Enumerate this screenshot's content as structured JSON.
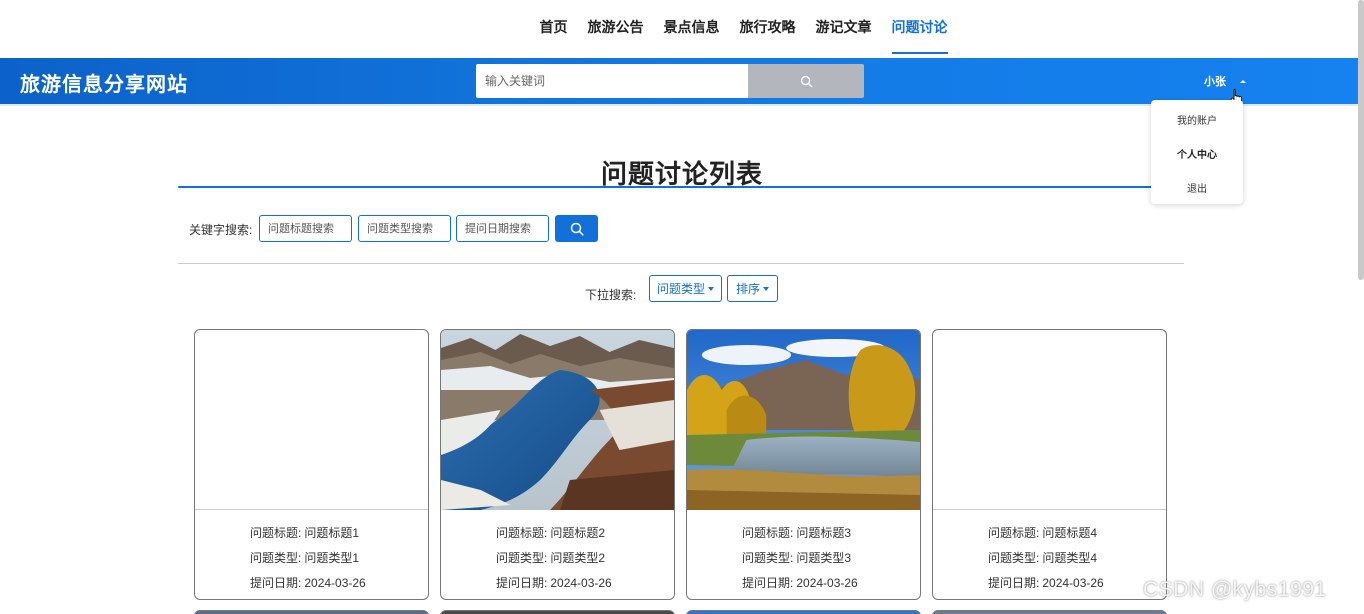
{
  "nav": {
    "items": [
      {
        "label": "首页",
        "active": false
      },
      {
        "label": "旅游公告",
        "active": false
      },
      {
        "label": "景点信息",
        "active": false
      },
      {
        "label": "旅行攻略",
        "active": false
      },
      {
        "label": "游记文章",
        "active": false
      },
      {
        "label": "问题讨论",
        "active": true
      }
    ]
  },
  "header": {
    "site_title": "旅游信息分享网站",
    "search_placeholder": "输入关键词",
    "user_name": "小张"
  },
  "user_menu": {
    "items": [
      {
        "label": "我的账户"
      },
      {
        "label": "个人中心"
      },
      {
        "label": "退出"
      }
    ]
  },
  "main": {
    "title": "问题讨论列表",
    "keyword_label": "关键字搜索:",
    "keyword_inputs": [
      {
        "placeholder": "问题标题搜索"
      },
      {
        "placeholder": "问题类型搜索"
      },
      {
        "placeholder": "提问日期搜索"
      }
    ],
    "dropdown_label": "下拉搜索:",
    "dropdowns": [
      {
        "label": "问题类型"
      },
      {
        "label": "排序"
      }
    ]
  },
  "cards": [
    {
      "image": "none",
      "title_label": "问题标题:",
      "title": "问题标题1",
      "type_label": "问题类型:",
      "type": "问题类型1",
      "date_label": "提问日期:",
      "date": "2024-03-26"
    },
    {
      "image": "mountain-river-photo",
      "title_label": "问题标题:",
      "title": "问题标题2",
      "type_label": "问题类型:",
      "type": "问题类型2",
      "date_label": "提问日期:",
      "date": "2024-03-26"
    },
    {
      "image": "autumn-river-photo",
      "title_label": "问题标题:",
      "title": "问题标题3",
      "type_label": "问题类型:",
      "type": "问题类型3",
      "date_label": "提问日期:",
      "date": "2024-03-26"
    },
    {
      "image": "none",
      "title_label": "问题标题:",
      "title": "问题标题4",
      "type_label": "问题类型:",
      "type": "问题类型4",
      "date_label": "提问日期:",
      "date": "2024-03-26"
    }
  ],
  "watermark": "CSDN @kybs1991",
  "colors": {
    "accent": "#1370d8",
    "header_blue": "#1379e2",
    "search_button_gray": "#b3b7bd"
  }
}
